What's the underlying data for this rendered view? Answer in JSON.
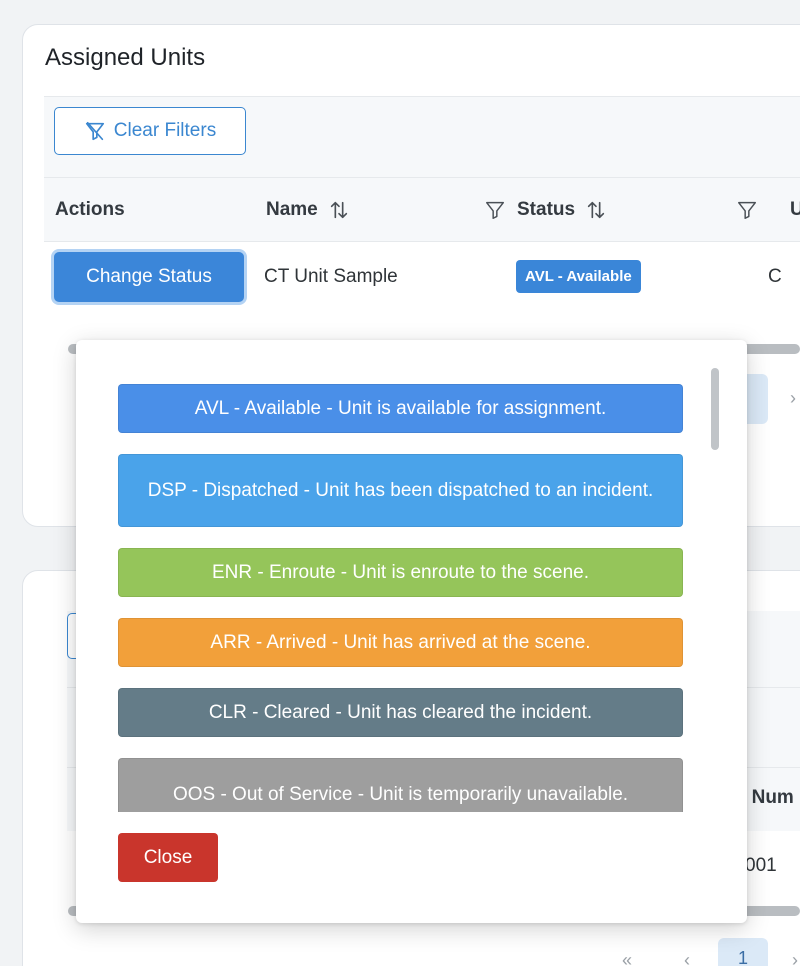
{
  "assigned_units": {
    "title": "Assigned Units",
    "clear_filters_label": "Clear Filters",
    "columns": {
      "actions": "Actions",
      "name": "Name",
      "status": "Status",
      "cut": "U"
    },
    "row": {
      "action_label": "Change Status",
      "name": "CT Unit Sample",
      "status_badge": "AVL - Available",
      "cut": "C"
    }
  },
  "status_popover": {
    "options": [
      {
        "label": "AVL - Available - Unit is available for assignment.",
        "color": "#4a8fe8"
      },
      {
        "label": "DSP - Dispatched - Unit has been dispatched to an incident.",
        "color": "#4aa3ea"
      },
      {
        "label": "ENR - Enroute - Unit is enroute to the scene.",
        "color": "#95c55a"
      },
      {
        "label": "ARR - Arrived - Unit has arrived at the scene.",
        "color": "#f2a03a"
      },
      {
        "label": "CLR - Cleared - Unit has cleared the incident.",
        "color": "#647c88"
      },
      {
        "label": "OOS - Out of Service - Unit is temporarily unavailable.",
        "color": "#9e9e9e"
      }
    ],
    "close_label": "Close"
  },
  "background": {
    "partial_header": "t Num",
    "partial_cell": "001",
    "page_number": "1",
    "pager_first": "«",
    "pager_prev": "‹",
    "pager_next": "›"
  }
}
